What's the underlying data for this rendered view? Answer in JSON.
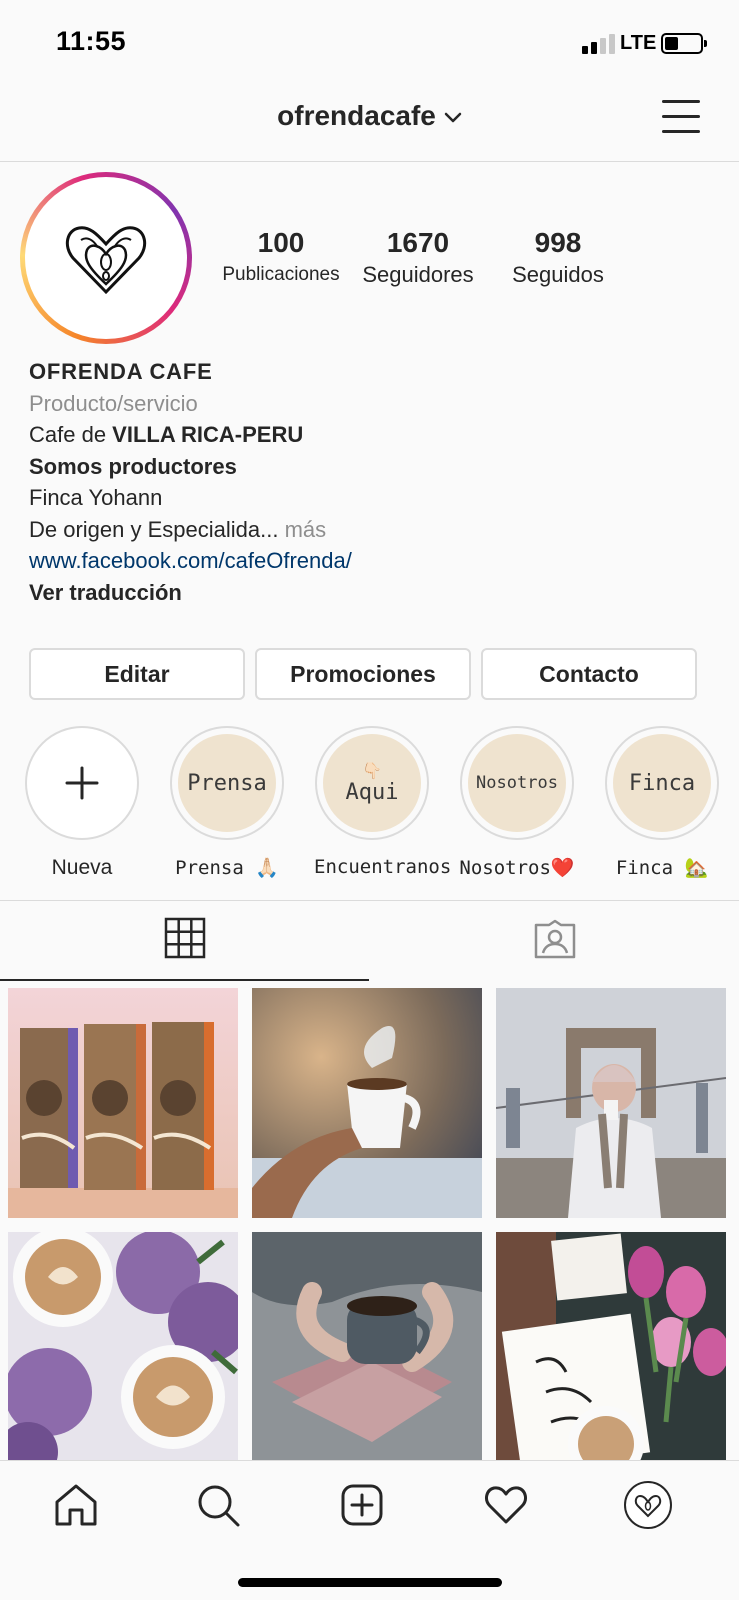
{
  "status_bar": {
    "time": "11:55",
    "network": "LTE"
  },
  "header": {
    "username": "ofrendacafe"
  },
  "profile": {
    "stats": [
      {
        "value": "100",
        "label": "Publicaciones"
      },
      {
        "value": "1670",
        "label": "Seguidores"
      },
      {
        "value": "998",
        "label": "Seguidos"
      }
    ],
    "bio": {
      "name": "OFRENDA CAFE",
      "category": "Producto/servicio",
      "line1_prefix": "Cafe de ",
      "line1_bold": "VILLA RICA-PERU",
      "line2": "Somos productores",
      "line3": "Finca Yohann",
      "line4": "De origen y Especialida...",
      "more": " más",
      "link": "www.facebook.com/cafeOfrenda/",
      "translate": "Ver traducción"
    }
  },
  "buttons": {
    "edit": "Editar",
    "promotions": "Promociones",
    "contact": "Contacto"
  },
  "highlights": [
    {
      "cover": "",
      "caption": "Nueva"
    },
    {
      "cover": "Prensa",
      "caption": "Prensa 🙏🏻"
    },
    {
      "cover": "Aqui",
      "cover_top": "👇🏻",
      "caption": "Encuentranos"
    },
    {
      "cover": "Nosotros",
      "caption": "Nosotros❤️"
    },
    {
      "cover": "Finca",
      "caption": "Finca 🏡"
    }
  ],
  "posts": [
    {
      "description": "coffee-bags-photo"
    },
    {
      "description": "hand-holding-coffee-cup-photo"
    },
    {
      "description": "woman-on-bridge-photo"
    },
    {
      "description": "latte-art-lilacs-photo"
    },
    {
      "description": "hands-holding-mug-photo"
    },
    {
      "description": "love-coffee-tulips-photo"
    }
  ],
  "colors": {
    "link": "#00376b",
    "muted": "#8e8e8e",
    "highlight_bg": "#efe3cf",
    "text": "#262626"
  }
}
